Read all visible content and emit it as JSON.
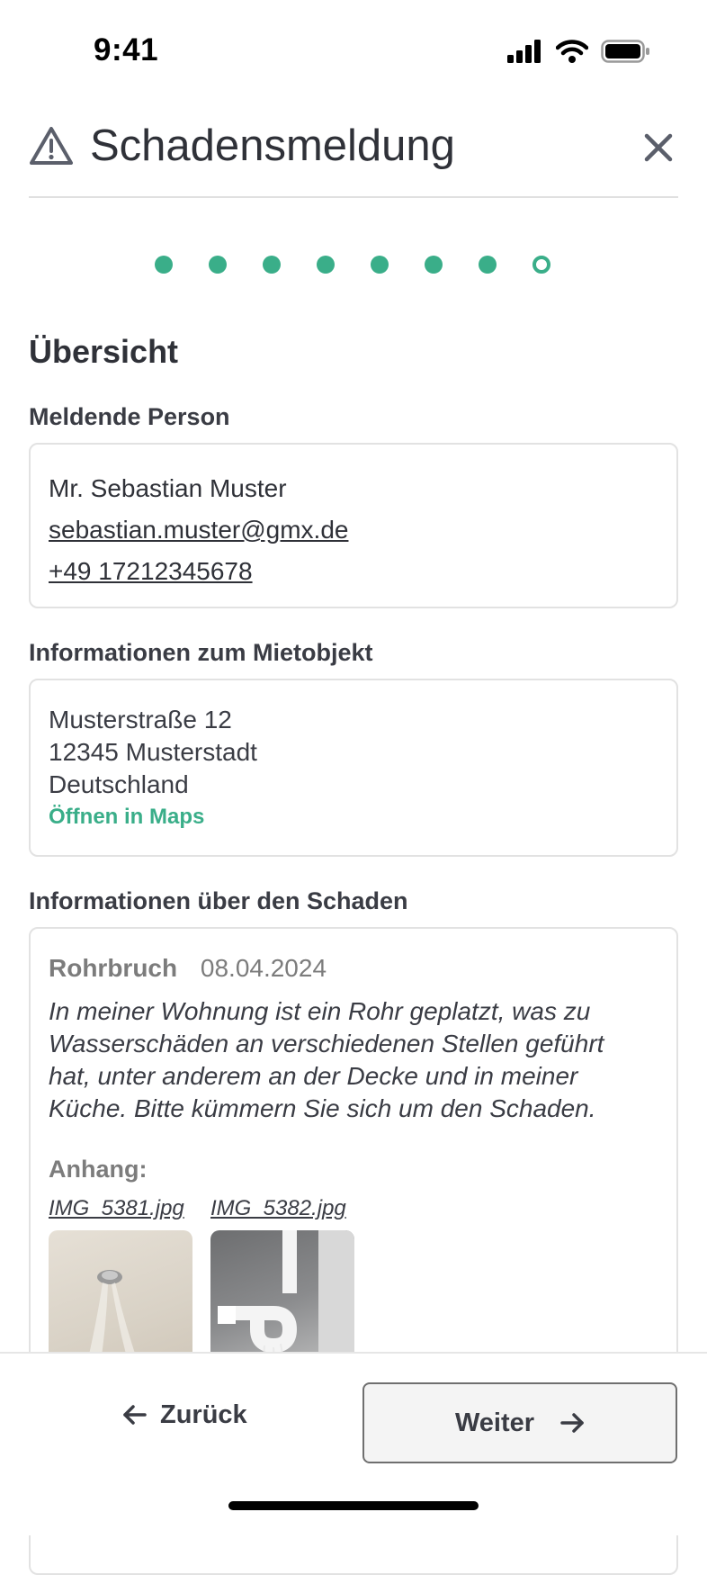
{
  "status_bar": {
    "time": "9:41"
  },
  "header": {
    "title": "Schadensmeldung"
  },
  "stepper": {
    "steps_total": 8,
    "steps_completed": 7
  },
  "overview": {
    "title": "Übersicht",
    "reporter": {
      "label": "Meldende Person",
      "name": "Mr. Sebastian Muster",
      "email": "sebastian.muster@gmx.de",
      "phone": "+49 17212345678"
    },
    "property": {
      "label": "Informationen zum Mietobjekt",
      "street": "Musterstraße 12",
      "city": "12345 Musterstadt",
      "country": "Deutschland",
      "maps_link": "Öffnen in Maps"
    },
    "damage": {
      "label": "Informationen über den Schaden",
      "type": "Rohrbruch",
      "date": "08.04.2024",
      "description": "In meiner Wohnung ist ein Rohr geplatzt, was zu Wasserschäden an verschiedenen Stellen geführt hat, unter anderem an der Decke und in meiner Küche. Bitte kümmern Sie sich um den Schaden.",
      "attachments_label": "Anhang:",
      "attachments": [
        {
          "filename": "IMG_5381.jpg"
        },
        {
          "filename": "IMG_5382.jpg"
        }
      ]
    }
  },
  "footer": {
    "back_label": "Zurück",
    "next_label": "Weiter"
  },
  "colors": {
    "accent": "#3aae89",
    "text": "#2f3138",
    "muted": "#7c7c7c"
  }
}
